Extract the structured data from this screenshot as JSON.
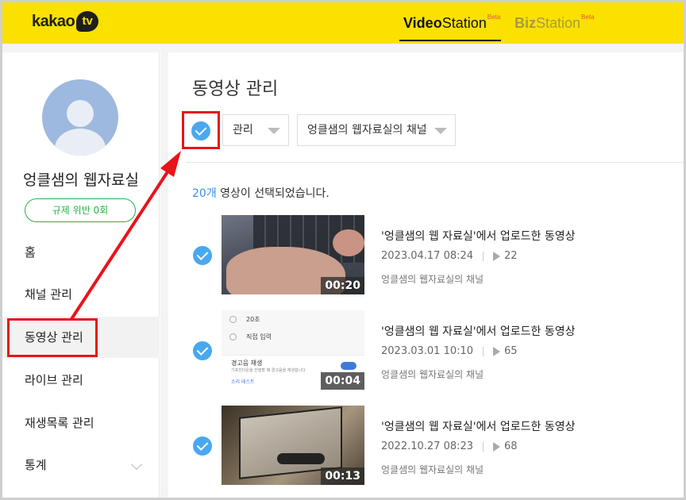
{
  "header": {
    "logo_text": "kakao",
    "logo_badge": "tv",
    "video_station": {
      "bold": "Video",
      "thin": "Station",
      "badge": "Beta"
    },
    "biz_station": {
      "bold": "Biz",
      "thin": "Station",
      "badge": "Beta"
    }
  },
  "sidebar": {
    "channel_name": "엉클샘의 웹자료실",
    "violation_label": "규제 위반 0회",
    "items": [
      {
        "label": "홈"
      },
      {
        "label": "채널 관리"
      },
      {
        "label": "동영상 관리"
      },
      {
        "label": "라이브 관리"
      },
      {
        "label": "재생목록 관리"
      },
      {
        "label": "통계"
      }
    ]
  },
  "main": {
    "title": "동영상 관리",
    "manage_dropdown": "관리",
    "channel_dropdown": "엉클샘의 웹자료실의 채널",
    "selected_count": "20개",
    "selected_suffix": " 영상이 선택되었습니다.",
    "videos": [
      {
        "title": "'엉클샘의 웹 자료실'에서 업로드한 동영상",
        "date": "2023.04.17 08:24",
        "views": "22",
        "channel": "엉클샘의 웹자료실의 채널",
        "duration": "00:20"
      },
      {
        "title": "'엉클샘의 웹 자료실'에서 업로드한 동영상",
        "date": "2023.03.01 10:10",
        "views": "65",
        "channel": "엉클샘의 웹자료실의 채널",
        "duration": "00:04",
        "thumb_text": {
          "opt1": "20초",
          "opt2": "직접 입력",
          "card_title": "경고음 재생",
          "card_sub": "기포진다운을 진행할 때 경고음을 재생합니다",
          "card_link": "소리 테스트"
        }
      },
      {
        "title": "'엉클샘의 웹 자료실'에서 업로드한 동영상",
        "date": "2022.10.27 08:23",
        "views": "68",
        "channel": "엉클샘의 웹자료실의 채널",
        "duration": "00:13"
      }
    ]
  },
  "colors": {
    "header_bg": "#fae100",
    "accent_blue": "#49a8f0",
    "highlight_red": "#e8141b",
    "violation_green": "#27b24a"
  }
}
